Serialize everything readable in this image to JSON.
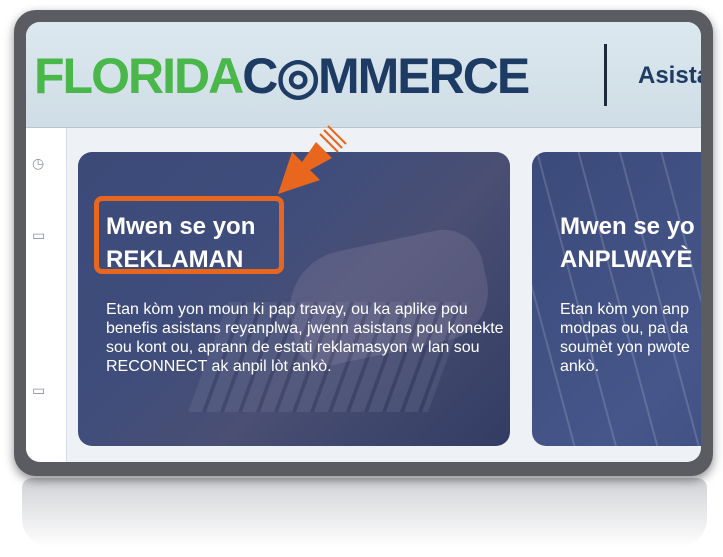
{
  "header": {
    "logo_part1": "FLORIDA",
    "logo_part2": "C",
    "logo_part3": "MMERCE",
    "right_text": "Asista"
  },
  "cards": [
    {
      "title_line1": "Mwen se yon",
      "title_line2": "REKLAMAN",
      "description": "Etan kòm yon moun ki pap travay, ou ka aplike pou benefis asistans reyanplwa, jwenn asistans pou konekte sou kont ou, aprann de estati reklamasyon w lan sou RECONNECT ak anpil lòt ankò."
    },
    {
      "title_line1": "Mwen se yo",
      "title_line2": "ANPLWAYÈ",
      "description": "Etan kòm yon anp modpas ou, pa da soumèt yon pwote ankò."
    }
  ],
  "colors": {
    "highlight": "#e8661d",
    "logo_green": "#49b749",
    "logo_navy": "#1e3b63"
  },
  "icons": [
    "clock-icon",
    "folder-icon",
    "card-icon",
    "arrow-icon"
  ]
}
